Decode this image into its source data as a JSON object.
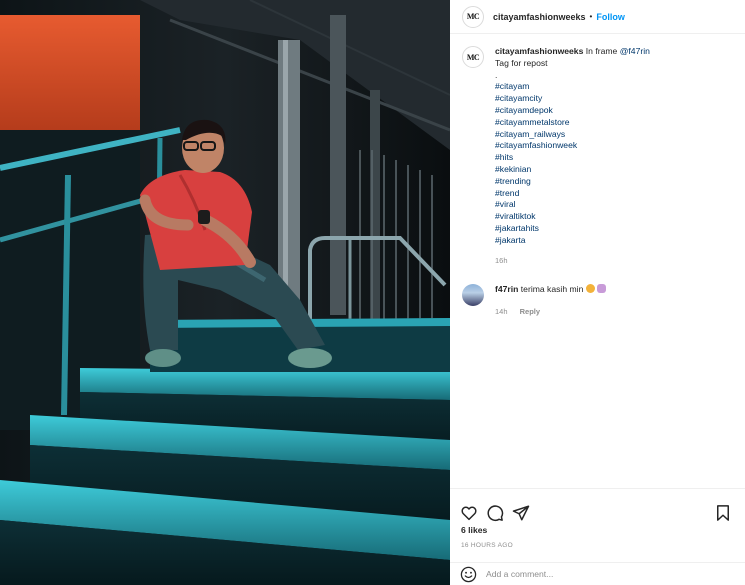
{
  "post": {
    "username": "citayamfashionweeks",
    "follow_label": "Follow",
    "avatar_text": "MC",
    "photo_alt": "Man in red shirt sitting on illuminated teal steps at night"
  },
  "caption": {
    "username": "citayamfashionweeks",
    "line_prefix": "In frame ",
    "mention": "@f47rin",
    "line2": "Tag for repost",
    "line3": ".",
    "hashtags": [
      "#citayam",
      "#citayamcity",
      "#citayamdepok",
      "#citayammetalstore",
      "#citayam_railways",
      "#citayamfashionweek",
      "#hits",
      "#kekinian",
      "#trending",
      "#trend",
      "#viral",
      "#viraltiktok",
      "#jakartahits",
      "#jakarta"
    ],
    "age": "16h"
  },
  "reply": {
    "username": "f47rin",
    "text": "terima kasih min",
    "age": "14h",
    "reply_label": "Reply"
  },
  "actions": {
    "icons": [
      "heart-icon",
      "comment-icon",
      "share-icon",
      "bookmark-icon"
    ]
  },
  "likes_text": "6 likes",
  "timestamp": "16 HOURS AGO",
  "comment_input": {
    "placeholder": "Add a comment..."
  },
  "colors": {
    "follow": "#0095f6",
    "link": "#00376b",
    "muted": "#8e8e8e",
    "stair_teal": "#2fb9c9",
    "shirt_red": "#d8403f",
    "wall_orange": "#e0532a"
  }
}
